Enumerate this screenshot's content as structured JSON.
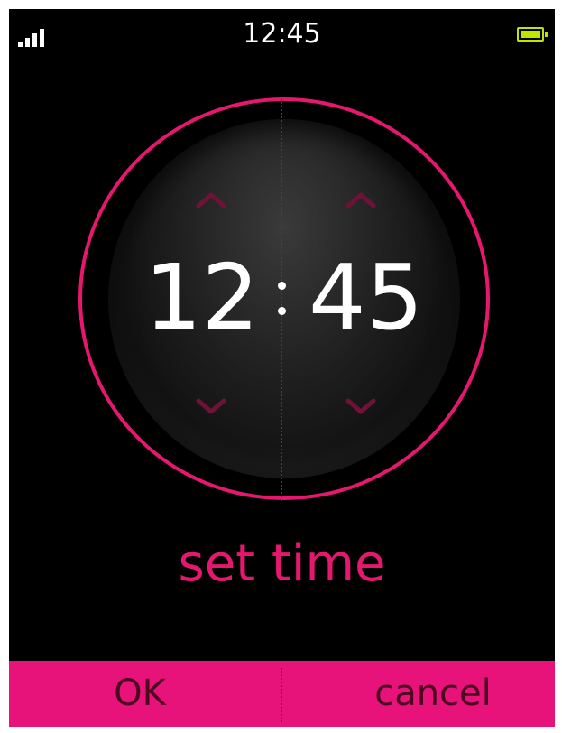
{
  "status_bar": {
    "time": "12:45",
    "signal_icon": "signal-bars-icon",
    "battery_icon": "battery-full-icon",
    "battery_color": "#bfe400"
  },
  "time_picker": {
    "hours": "12",
    "minutes": "45",
    "separator_icon": "colon-icon",
    "up_icon": "chevron-up-icon",
    "down_icon": "chevron-down-icon",
    "label": "set time",
    "accent_color": "#e6176f"
  },
  "softkeys": {
    "ok_label": "OK",
    "cancel_label": "cancel",
    "bar_color": "#e8137a"
  }
}
